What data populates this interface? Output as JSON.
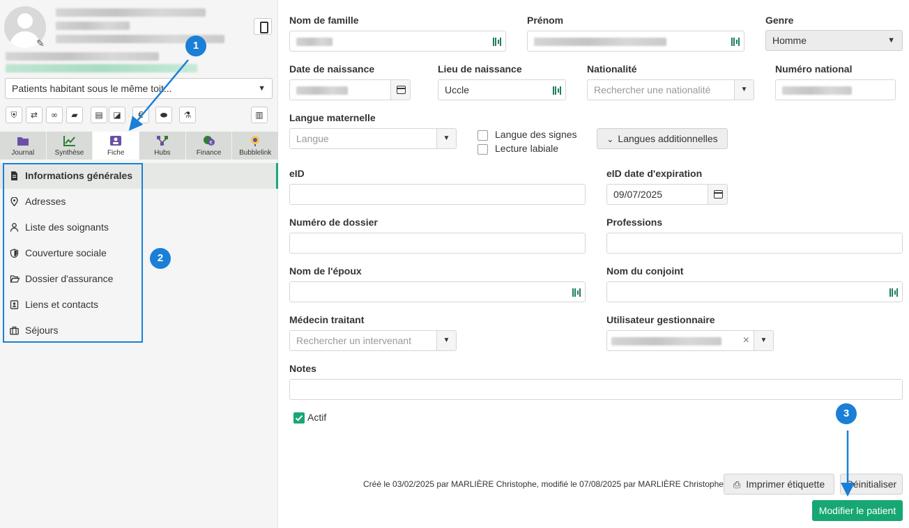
{
  "sidebar": {
    "household_select": "Patients habitant sous le même toit...",
    "quick_icons": [
      "shield-icon",
      "handshake-icon",
      "link-icon",
      "folder-icon",
      "clipboard-icon",
      "note-icon",
      "euro-icon",
      "pills-icon",
      "flask-icon",
      "pdf-icon"
    ],
    "tabs": [
      {
        "label": "Journal",
        "icon": "folder-icon"
      },
      {
        "label": "Synthèse",
        "icon": "chart-icon"
      },
      {
        "label": "Fiche",
        "icon": "id-card-icon"
      },
      {
        "label": "Hubs",
        "icon": "hub-icon"
      },
      {
        "label": "Finance",
        "icon": "finance-icon"
      },
      {
        "label": "Bubblelink",
        "icon": "bubblelink-icon"
      }
    ],
    "menu": [
      {
        "label": "Informations générales",
        "icon": "document-icon"
      },
      {
        "label": "Adresses",
        "icon": "map-pin-icon"
      },
      {
        "label": "Liste des soignants",
        "icon": "caregiver-icon"
      },
      {
        "label": "Couverture sociale",
        "icon": "shield-icon"
      },
      {
        "label": "Dossier d'assurance",
        "icon": "folder-open-icon"
      },
      {
        "label": "Liens et contacts",
        "icon": "contact-icon"
      },
      {
        "label": "Séjours",
        "icon": "briefcase-icon"
      }
    ]
  },
  "badges": [
    "1",
    "2",
    "3"
  ],
  "form": {
    "nom_label": "Nom de famille",
    "prenom_label": "Prénom",
    "genre_label": "Genre",
    "genre_value": "Homme",
    "dob_label": "Date de naissance",
    "lieu_label": "Lieu de naissance",
    "lieu_value": "Uccle",
    "nationalite_label": "Nationalité",
    "nationalite_placeholder": "Rechercher une nationalité",
    "numero_national_label": "Numéro national",
    "langue_label": "Langue maternelle",
    "langue_placeholder": "Langue",
    "langue_signes": "Langue des signes",
    "lecture_labiale": "Lecture labiale",
    "langues_add_button": "Langues additionnelles",
    "eid_label": "eID",
    "eid_exp_label": "eID date d'expiration",
    "eid_exp_value": "09/07/2025",
    "dossier_label": "Numéro de dossier",
    "professions_label": "Professions",
    "epoux_label": "Nom de l'époux",
    "conjoint_label": "Nom du conjoint",
    "medecin_label": "Médecin traitant",
    "medecin_placeholder": "Rechercher un intervenant",
    "gestionnaire_label": "Utilisateur gestionnaire",
    "notes_label": "Notes",
    "actif_label": "Actif",
    "actif_checked": true
  },
  "footer": {
    "created_text": "Créé le 03/02/2025 par MARLIÈRE Christophe, modifié le 07/08/2025 par MARLIÈRE Christophe",
    "print_button": "Imprimer étiquette",
    "reset_button": "Réinitialiser",
    "submit_button": "Modifier le patient"
  },
  "colors": {
    "accent_green": "#17a772",
    "annotation_blue": "#1a7fd6",
    "sidebar_bg": "#f4f5f4",
    "tab_bg": "#d8dbd8"
  }
}
